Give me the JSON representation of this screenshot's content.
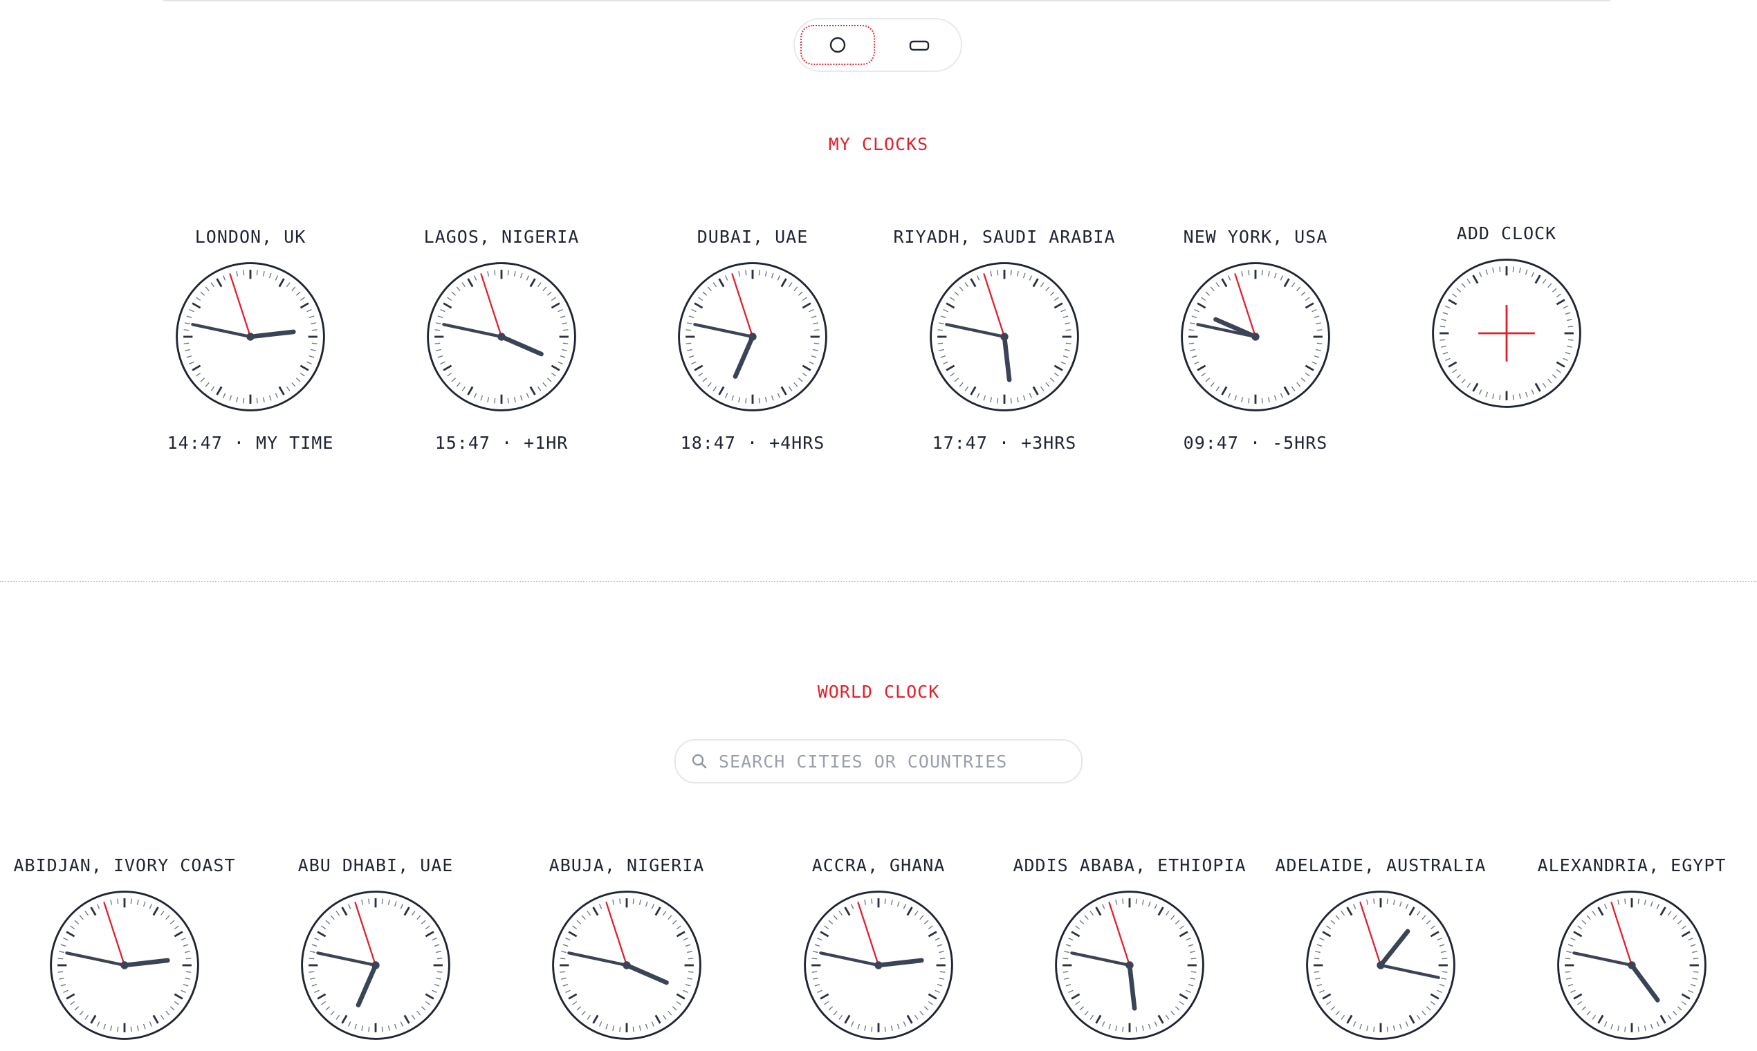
{
  "toggle": {
    "options": [
      {
        "icon": "circle-icon",
        "selected": true
      },
      {
        "icon": "rounded-rect-icon",
        "selected": false
      }
    ]
  },
  "my_clocks": {
    "title": "MY CLOCKS",
    "clocks": [
      {
        "city": "LONDON, UK",
        "time": "14:47 · MY TIME",
        "hour": 14,
        "minute": 47
      },
      {
        "city": "LAGOS, NIGERIA",
        "time": "15:47 · +1HR",
        "hour": 15,
        "minute": 47
      },
      {
        "city": "DUBAI, UAE",
        "time": "18:47 · +4HRS",
        "hour": 18,
        "minute": 47
      },
      {
        "city": "RIYADH, SAUDI ARABIA",
        "time": "17:47 · +3HRS",
        "hour": 17,
        "minute": 47
      },
      {
        "city": "NEW YORK, USA",
        "time": "09:47 · -5HRS",
        "hour": 9,
        "minute": 47
      }
    ],
    "add_clock_label": "ADD CLOCK"
  },
  "world_clock": {
    "title": "WORLD CLOCK",
    "search_placeholder": "SEARCH CITIES OR COUNTRIES",
    "clocks": [
      {
        "city": "ABIDJAN, IVORY COAST",
        "hour": 14,
        "minute": 47
      },
      {
        "city": "ABU DHABI, UAE",
        "hour": 18,
        "minute": 47
      },
      {
        "city": "ABUJA, NIGERIA",
        "hour": 15,
        "minute": 47
      },
      {
        "city": "ACCRA, GHANA",
        "hour": 14,
        "minute": 47
      },
      {
        "city": "ADDIS ABABA, ETHIOPIA",
        "hour": 17,
        "minute": 47
      },
      {
        "city": "ADELAIDE, AUSTRALIA",
        "hour": 1,
        "minute": 17
      },
      {
        "city": "ALEXANDRIA, EGYPT",
        "hour": 16,
        "minute": 47
      }
    ]
  },
  "colors": {
    "accent": "#e0202a",
    "hand": "#3a4456",
    "face_border": "#1f2533",
    "tick": "#2a3140"
  },
  "second_hand_seconds": 57
}
